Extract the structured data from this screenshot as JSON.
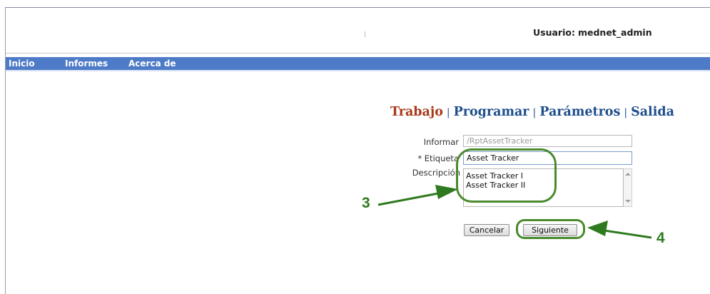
{
  "header": {
    "user_label": "Usuario:",
    "user_name": "mednet_admin"
  },
  "nav": {
    "items": [
      {
        "label": "Inicio"
      },
      {
        "label": "Informes"
      },
      {
        "label": "Acerca de"
      }
    ],
    "bar_color": "#4e7bc7"
  },
  "wizard": {
    "steps": [
      "Trabajo",
      "Programar",
      "Parámetros",
      "Salida"
    ],
    "separator": "|",
    "active_step": "Trabajo",
    "active_color": "#a83a1a",
    "link_color": "#1e4e8c"
  },
  "form": {
    "informar": {
      "label": "Informar",
      "value": "/RptAssetTracker"
    },
    "etiqueta": {
      "label": "* Etiqueta",
      "value": "Asset Tracker"
    },
    "descripcion": {
      "label": "Descripción",
      "lines": [
        "Asset Tracker I",
        "Asset Tracker II"
      ]
    }
  },
  "buttons": {
    "cancel_label": "Cancelar",
    "next_label": "Siguiente"
  },
  "annotations": {
    "callout_3": "3",
    "callout_4": "4",
    "color": "#2f7a1f"
  }
}
